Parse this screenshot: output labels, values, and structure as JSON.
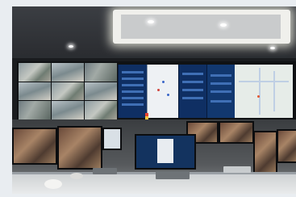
{
  "scene": {
    "colors": {
      "dashboard_blue": "#0f2f63",
      "map_background": "#e6ece8",
      "ceiling_light": "#f0f0ec"
    }
  }
}
